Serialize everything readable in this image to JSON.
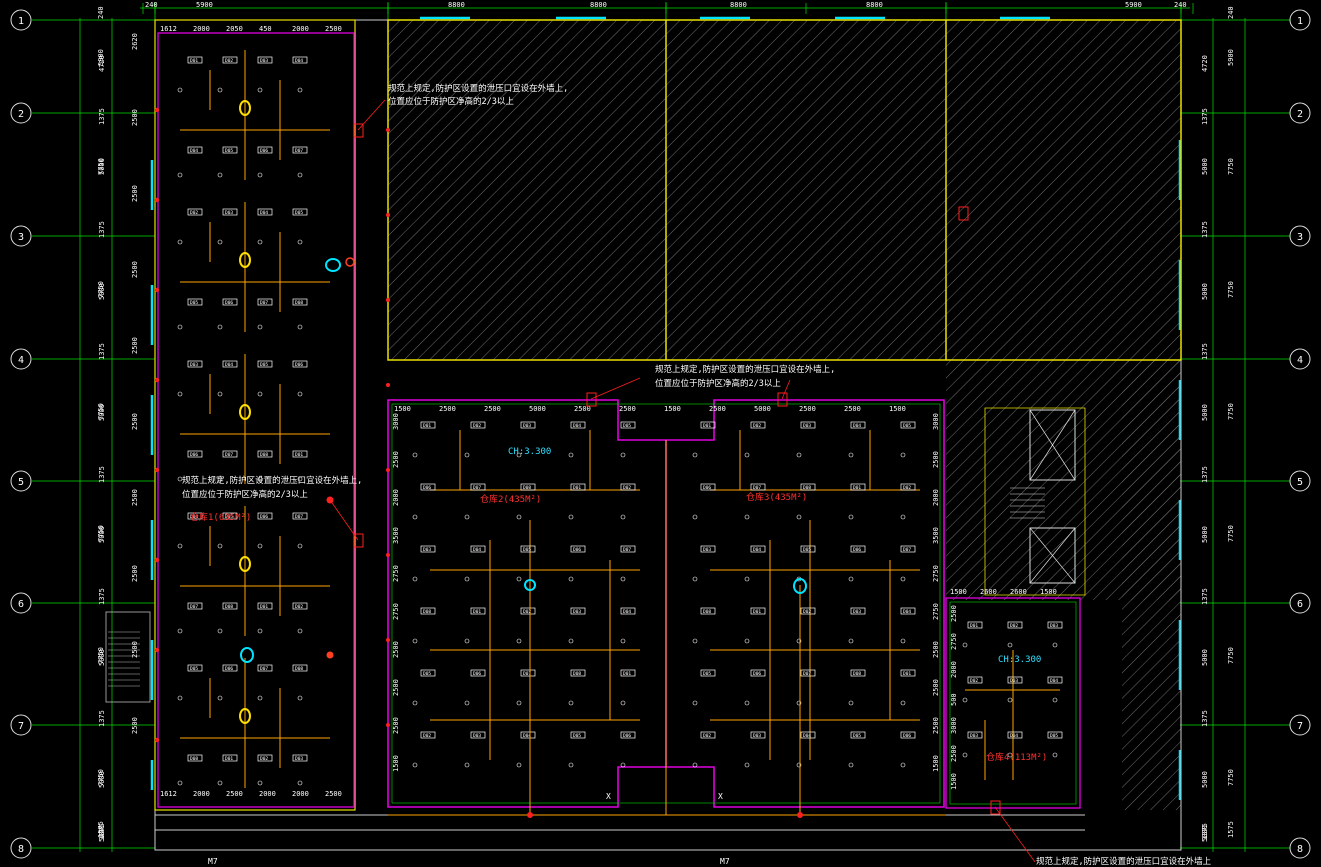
{
  "colors": {
    "background": "#000000",
    "axis": "#00e000",
    "wall_yellow": "#e8e000",
    "partition_magenta": "#e000e0",
    "cable_orange": "#ffa500",
    "window_cyan": "#00e5ff",
    "text_red": "#ff3030",
    "text_cyan": "#30e0ff",
    "hatch": "#7a7a7a"
  },
  "top_dims": {
    "left": [
      "240",
      "5900"
    ],
    "mid": [
      "8800",
      "8800",
      "8800",
      "8800"
    ],
    "right": [
      "5900",
      "240"
    ]
  },
  "left_dims": {
    "outer": [
      "240",
      "5900",
      "7750",
      "7750",
      "7750",
      "7750",
      "7750",
      "7750",
      "1575"
    ],
    "inner": [
      "4720",
      "1375",
      "5000",
      "1375",
      "5000",
      "1375",
      "5000",
      "1375",
      "5000",
      "1375",
      "5000",
      "1375",
      "5000",
      "1375",
      "5000",
      "1375"
    ]
  },
  "right_dims": {
    "outer": [
      "240",
      "5900",
      "7750",
      "7750",
      "7750",
      "7750",
      "7750",
      "7750",
      "1575"
    ],
    "inner": [
      "4720",
      "1375",
      "5000",
      "1375",
      "5000",
      "1375",
      "5000",
      "1375",
      "5000",
      "1375",
      "5000",
      "1375",
      "5000",
      "1375",
      "5000",
      "1375"
    ]
  },
  "axes": {
    "rows": [
      "1",
      "2",
      "3",
      "4",
      "5",
      "6",
      "7",
      "8"
    ]
  },
  "left_room": {
    "top_dims": [
      "1612",
      "2000",
      "2050",
      "450",
      "2000",
      "2500"
    ],
    "bottom_dims": [
      "1612",
      "2000",
      "2500",
      "2000",
      "2000",
      "2500"
    ],
    "vertical_dims": [
      "2620",
      "2500",
      "2500",
      "2500",
      "2500",
      "2500",
      "2500",
      "2500",
      "2500",
      "2500"
    ],
    "name": "仓库1(635M²)",
    "note": [
      "规范上规定,防护区设置的泄压口宜设在外墙上,",
      "位置应位于防护区净高的2/3以上"
    ]
  },
  "mid_room": {
    "top_dims": [
      "1500",
      "2500",
      "2500",
      "5000",
      "2500",
      "2500",
      "1500",
      "2500",
      "5000",
      "2500",
      "2500",
      "1500"
    ],
    "ch": "CH:3.300",
    "room2": "仓库2(435M²)",
    "room3": "仓库3(435M²)",
    "note": [
      "规范上规定,防护区设置的泄压口宜设在外墙上,",
      "位置应位于防护区净高的2/3以上"
    ],
    "vertical_dims": [
      "3000",
      "2500",
      "2000",
      "3500",
      "2750",
      "2750",
      "2500",
      "2500",
      "2500",
      "1500"
    ]
  },
  "right_room": {
    "ch": "CH:3.300",
    "name": "仓库4(113M²)",
    "top_dims": [
      "1500",
      "2600",
      "2600",
      "1500"
    ],
    "vertical_dims": [
      "2500",
      "2750",
      "2000",
      "500",
      "3000",
      "2500",
      "1500"
    ]
  },
  "upper_note": [
    "规范上规定,防护区设置的泄压口宜设在外墙上,",
    "位置应位于防护区净高的2/3以上"
  ],
  "bottom_note": "规范上规定,防护区设置的泄压口宜设在外墙上",
  "door_labels": [
    "M7",
    "M7"
  ],
  "grid_markers": [
    "X",
    "X"
  ],
  "device_labels": [
    "D01",
    "D02",
    "D03",
    "D04",
    "D05",
    "D06",
    "D07",
    "D08"
  ]
}
